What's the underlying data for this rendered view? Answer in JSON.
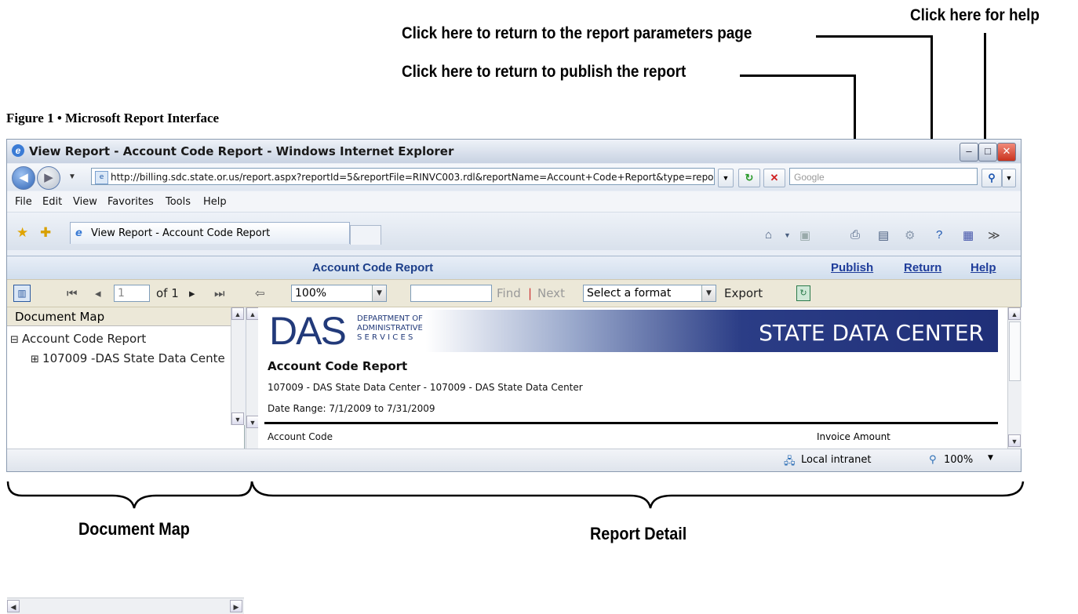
{
  "callouts": {
    "help": "Click here for help",
    "return_params": "Click here to return to the report parameters page",
    "publish": "Click here to return to publish the report"
  },
  "figure_caption": "Figure 1 • Microsoft Report Interface",
  "window": {
    "title": "View Report - Account Code Report - Windows Internet Explorer",
    "address": "http://billing.sdc.state.or.us/report.aspx?reportId=5&reportFile=RINVC003.rdl&reportName=Account+Code+Report&type=reports&",
    "search_placeholder": "Google",
    "menu": [
      "File",
      "Edit",
      "View",
      "Favorites",
      "Tools",
      "Help"
    ],
    "tab_title": "View Report - Account Code Report"
  },
  "report_header": {
    "title": "Account Code Report",
    "publish": "Publish",
    "return": "Return",
    "help": "Help"
  },
  "toolbar": {
    "page_value": "1",
    "page_of": "of 1",
    "zoom": "100%",
    "find_value": "",
    "find": "Find",
    "separator": "|",
    "next": "Next",
    "format": "Select a format",
    "export": "Export"
  },
  "document_map": {
    "header": "Document Map",
    "root": "Account Code Report",
    "child": "107009 -DAS State Data Cente"
  },
  "report": {
    "logo": "DAS",
    "dept_lines": [
      "DEPARTMENT OF",
      "ADMINISTRATIVE",
      "S E R V I C E S"
    ],
    "banner": "STATE DATA CENTER",
    "title": "Account Code Report",
    "subtitle": "107009 - DAS State Data Center - 107009 - DAS State Data Center",
    "date_range": "Date Range: 7/1/2009 to 7/31/2009",
    "col_account": "Account Code",
    "col_invoice": "Invoice Amount"
  },
  "status": {
    "zone": "Local intranet",
    "zoom": "100%"
  },
  "labels": {
    "document_map": "Document Map",
    "report_detail": "Report Detail"
  }
}
